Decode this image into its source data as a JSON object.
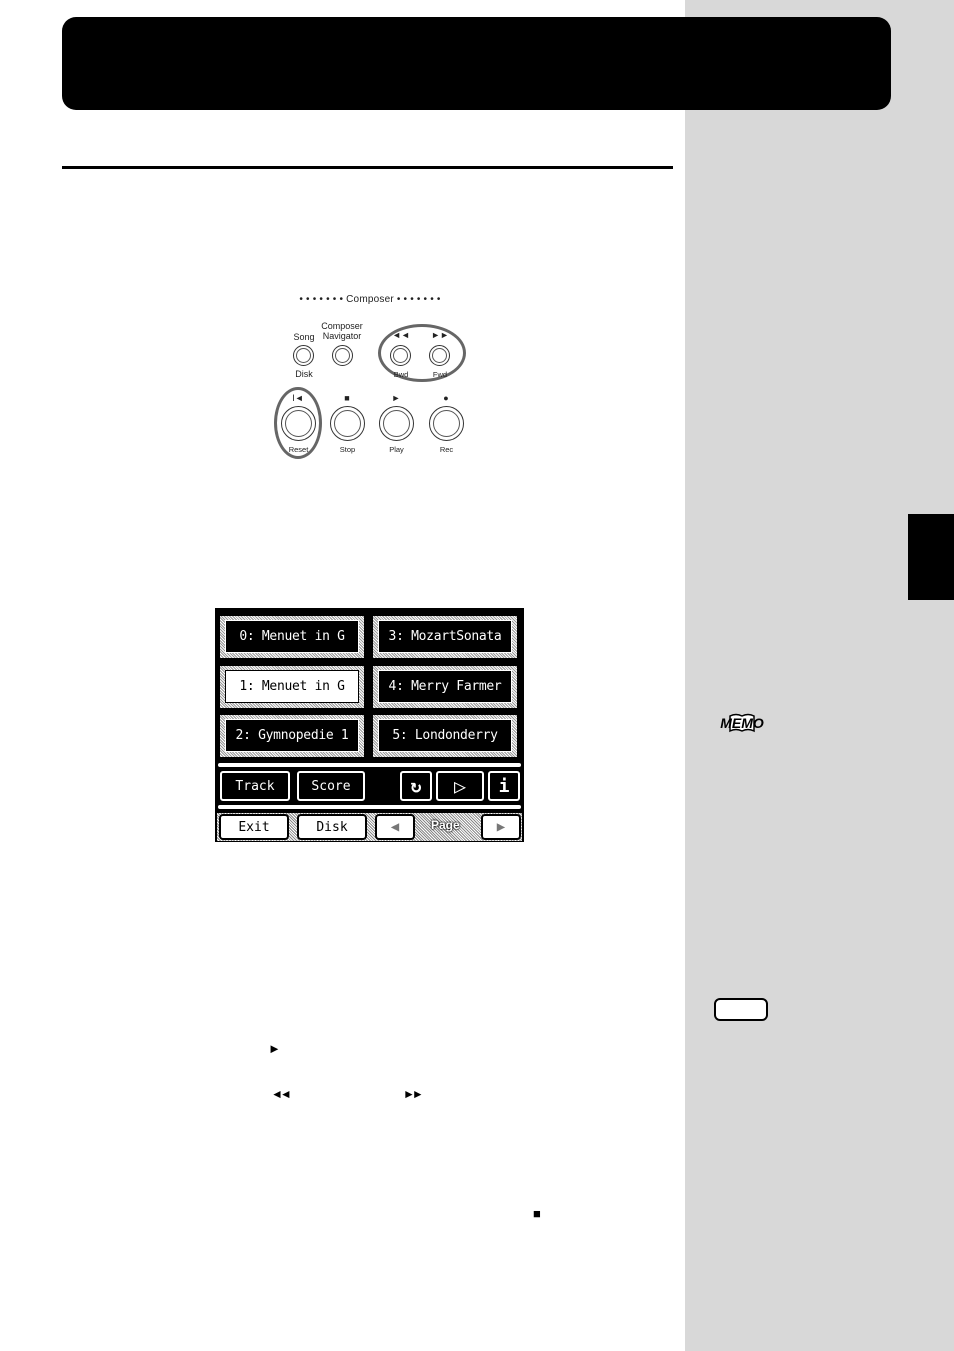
{
  "page": {
    "accent_color": "#000000",
    "sidebar_color": "#d8d8d8"
  },
  "composer_panel": {
    "title": "• • • • • • • Composer • • • • • • •",
    "buttons": [
      {
        "name": "song",
        "top_label": "Song",
        "bottom_label": "Disk"
      },
      {
        "name": "composer-navigator",
        "top_label": "Composer Navigator",
        "bottom_label": ""
      },
      {
        "name": "bwd",
        "symbol": "◄◄",
        "bottom_label": "Bwd",
        "highlighted": true
      },
      {
        "name": "fwd",
        "symbol": "►►",
        "bottom_label": "Fwd",
        "highlighted": true
      },
      {
        "name": "reset",
        "symbol": "I◄",
        "bottom_label": "Reset",
        "highlighted": true
      },
      {
        "name": "stop",
        "symbol": "■",
        "bottom_label": "Stop"
      },
      {
        "name": "play",
        "symbol": "►",
        "bottom_label": "Play"
      },
      {
        "name": "rec",
        "symbol": "●",
        "bottom_label": "Rec"
      }
    ],
    "composer_navigator_line1": "Composer",
    "composer_navigator_line2": "Navigator"
  },
  "lcd_screen": {
    "songs": [
      {
        "label": "0: Menuet in G",
        "selected": false
      },
      {
        "label": "1: Menuet in G",
        "selected": true
      },
      {
        "label": "2: Gymnopedie 1",
        "selected": false
      },
      {
        "label": "3: MozartSonata",
        "selected": false
      },
      {
        "label": "4: Merry Farmer",
        "selected": false
      },
      {
        "label": "5: Londonderry",
        "selected": false
      }
    ],
    "track_label": "Track",
    "score_label": "Score",
    "loop_icon": "↻",
    "play_icon": "▷",
    "info_icon": "i",
    "exit_label": "Exit",
    "disk_label": "Disk",
    "page_label": "Page",
    "page_prev_icon": "◀",
    "page_next_icon": "▶"
  },
  "sidebar": {
    "memo_label": "MEMO"
  },
  "inline_symbols": {
    "play": "►",
    "rewind": "◄◄",
    "fast_forward": "►►",
    "stop": "■"
  }
}
